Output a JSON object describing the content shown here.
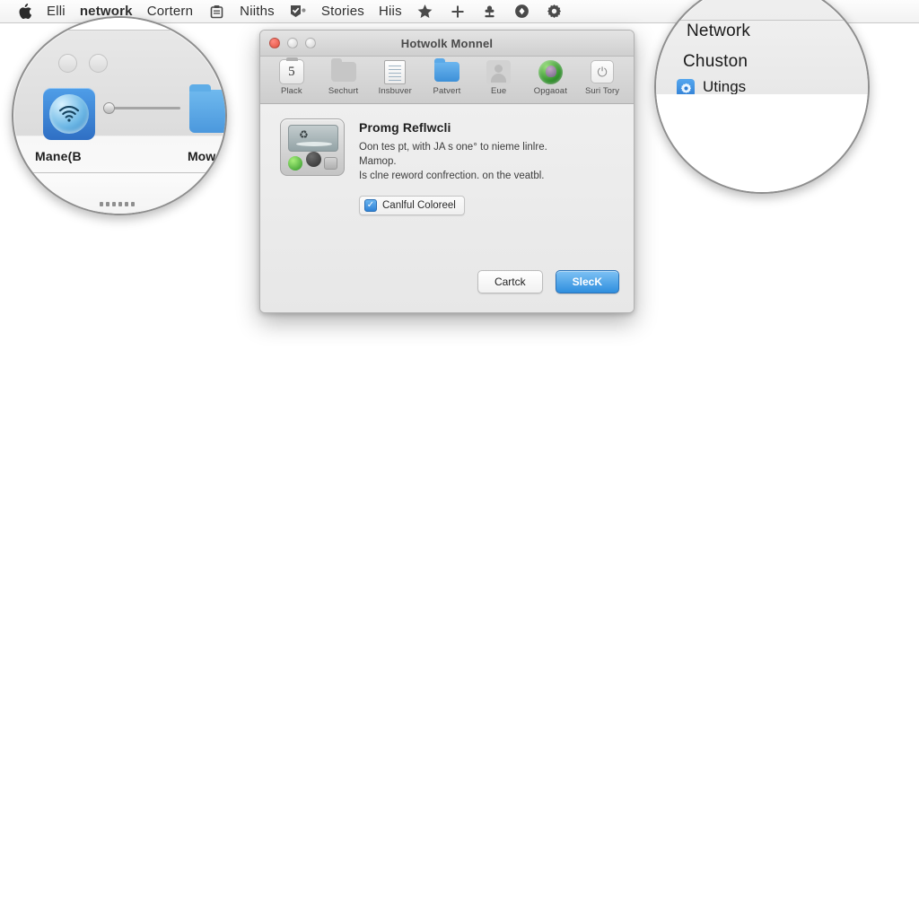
{
  "menubar": {
    "apple_icon": "apple-logo-icon",
    "items": [
      {
        "label": "Elli",
        "type": "text",
        "bold": false
      },
      {
        "label": "network",
        "type": "text",
        "bold": true
      },
      {
        "label": "Cortern",
        "type": "text",
        "bold": false
      },
      {
        "label": "clipboard-icon",
        "type": "icon",
        "glyph": "▣"
      },
      {
        "label": "Niiths",
        "type": "text",
        "bold": false
      },
      {
        "label": "checkbox-badge-icon",
        "type": "icon",
        "glyph": "☑"
      },
      {
        "label": "Stories",
        "type": "text",
        "bold": false
      },
      {
        "label": "Hiis",
        "type": "text",
        "bold": false
      },
      {
        "label": "star-icon",
        "type": "icon",
        "glyph": "★"
      },
      {
        "label": "plus-icon",
        "type": "icon",
        "glyph": "＋"
      },
      {
        "label": "tree-icon",
        "type": "icon",
        "glyph": "☘"
      },
      {
        "label": "target-circle-icon",
        "type": "icon",
        "glyph": "◉"
      },
      {
        "label": "gear-icon",
        "type": "icon",
        "glyph": "⚙"
      }
    ]
  },
  "dialog": {
    "title": "Hotwolk Monnel",
    "traffic_lights": {
      "close": "close-button",
      "minimize": "minimize-button",
      "zoom": "zoom-button"
    },
    "toolbar": [
      {
        "label": "Plack",
        "icon": "clock-icon",
        "glyph": "5"
      },
      {
        "label": "Sechurt",
        "icon": "folder-gray-icon",
        "glyph": ""
      },
      {
        "label": "Insbuver",
        "icon": "document-icon",
        "glyph": ""
      },
      {
        "label": "Patvert",
        "icon": "folder-blue-icon",
        "glyph": ""
      },
      {
        "label": "Eue",
        "icon": "user-icon",
        "glyph": ""
      },
      {
        "label": "Opgaoat",
        "icon": "globe-icon",
        "glyph": ""
      },
      {
        "label": "Suri Tory",
        "icon": "power-icon",
        "glyph": "⏻"
      }
    ],
    "content": {
      "device_icon": "printer-device-icon",
      "heading": "Promg Reflwcli",
      "line1": "Oon tes pt, with JA s one° to nieme linlre.",
      "line2": "Mamop.",
      "line3": "Is clne reword confrection. on the veatbl.",
      "checkbox": {
        "label": "Canlful Coloreel",
        "checked": true,
        "check_glyph": "✓"
      }
    },
    "buttons": {
      "secondary": "Cartck",
      "primary": "SlecK"
    }
  },
  "magnifier_left": {
    "name": "zoom-lens-left",
    "wifi_tile_icon": "airdrop-wifi-icon",
    "wifi_glyph": "◔",
    "label_left": "Mane(B",
    "label_right": "Mow",
    "folder_icon": "folder-blue-icon",
    "slider": "volume-slider"
  },
  "magnifier_right": {
    "name": "zoom-lens-right",
    "item1": "Network",
    "item2": "Chuston",
    "item3": "Utings",
    "item3_icon": "settings-blue-icon",
    "item3_glyph": "⚙"
  },
  "colors": {
    "accent_blue": "#2f8ede",
    "close_red": "#e0503f",
    "window_gray": "#ececec",
    "menubar_bg": "#f7f7f7",
    "green_indicator": "#2f9428"
  }
}
